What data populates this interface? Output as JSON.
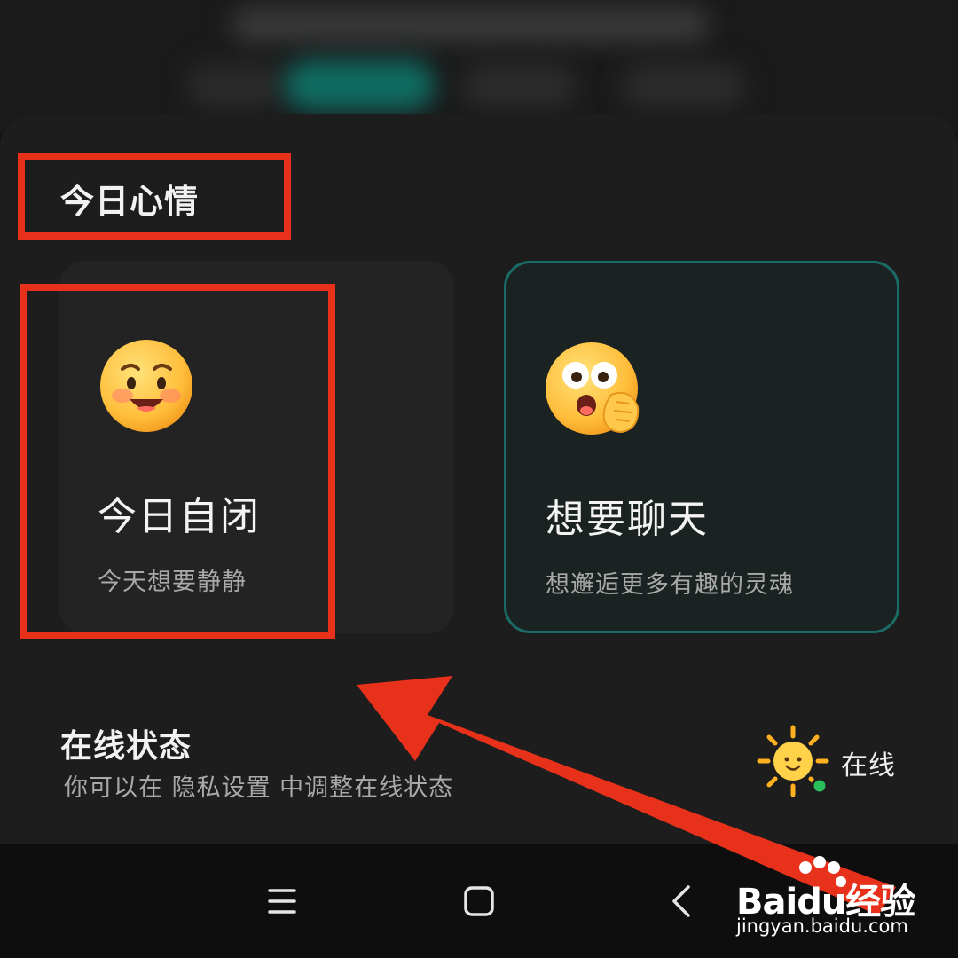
{
  "mood": {
    "section_title": "今日心情",
    "cards": [
      {
        "title": "今日自闭",
        "subtitle": "今天想要静静",
        "icon": "shy-smile-emoji-icon"
      },
      {
        "title": "想要聊天",
        "subtitle": "想邂逅更多有趣的灵魂",
        "icon": "excited-emoji-icon"
      }
    ]
  },
  "online_status": {
    "title": "在线状态",
    "description": "你可以在 隐私设置 中调整在线状态",
    "value": "在线",
    "icon": "sun-icon",
    "status_dot_color": "#2bbd5a"
  },
  "navbar": {
    "icons": [
      "menu-icon",
      "home-icon",
      "back-icon"
    ]
  },
  "watermark": {
    "brand_icon": "baidu-paw-icon",
    "text": "Baidu经验",
    "url": "jingyan.baidu.com"
  },
  "colors": {
    "accent_teal": "#1b6b66",
    "annotation_red": "#e8311a"
  }
}
